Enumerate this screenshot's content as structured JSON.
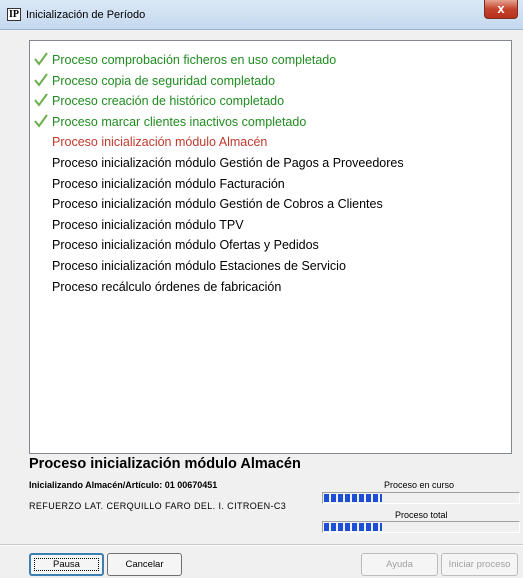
{
  "window": {
    "title": "Inicialización de Período",
    "app_icon_text": "IP",
    "close_glyph": "x"
  },
  "colors": {
    "completed": "#1f8c1f",
    "current": "#c0392b",
    "pending": "#000000",
    "check": "#6ab04c"
  },
  "processes": [
    {
      "label": "Proceso comprobación ficheros en uso completado",
      "status": "completed",
      "icon": "check-icon"
    },
    {
      "label": "Proceso copia de seguridad completado",
      "status": "completed",
      "icon": "check-icon"
    },
    {
      "label": "Proceso creación de histórico completado",
      "status": "completed",
      "icon": "check-icon"
    },
    {
      "label": "Proceso marcar clientes inactivos completado",
      "status": "completed",
      "icon": "check-icon"
    },
    {
      "label": "Proceso inicialización módulo Almacén",
      "status": "current"
    },
    {
      "label": "Proceso inicialización módulo Gestión de Pagos a Proveedores",
      "status": "pending"
    },
    {
      "label": "Proceso inicialización módulo Facturación",
      "status": "pending"
    },
    {
      "label": "Proceso inicialización módulo Gestión de Cobros a Clientes",
      "status": "pending"
    },
    {
      "label": "Proceso inicialización módulo TPV",
      "status": "pending"
    },
    {
      "label": "Proceso inicialización módulo Ofertas y Pedidos",
      "status": "pending"
    },
    {
      "label": "Proceso inicialización módulo Estaciones de Servicio",
      "status": "pending"
    },
    {
      "label": "Proceso recálculo órdenes de fabricación",
      "status": "pending"
    }
  ],
  "status": {
    "current_process": "Proceso inicialización módulo Almacén",
    "detail": "Inicializando Almacén/Artículo: 01 00670451",
    "article_description": "REFUERZO LAT. CERQUILLO FARO DEL. I. CITROEN-C3"
  },
  "progress": {
    "current_label": "Proceso en curso",
    "current_fraction": 0.3,
    "total_label": "Proceso total",
    "total_fraction": 0.3
  },
  "buttons": {
    "pause": "Pausa",
    "cancel": "Cancelar",
    "help": "Ayuda",
    "start": "Iniciar proceso"
  }
}
